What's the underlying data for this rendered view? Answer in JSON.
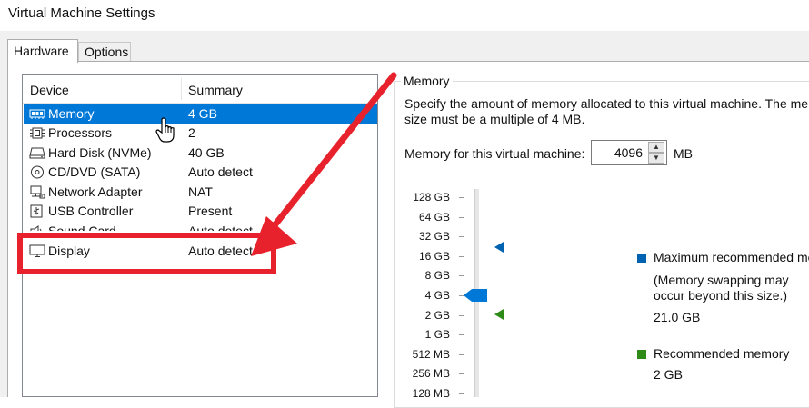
{
  "window": {
    "title": "Virtual Machine Settings"
  },
  "tabs": [
    {
      "label": "Hardware",
      "active": true
    },
    {
      "label": "Options",
      "active": false
    }
  ],
  "device_list": {
    "columns": {
      "device": "Device",
      "summary": "Summary"
    },
    "rows": [
      {
        "icon": "memory-icon",
        "device": "Memory",
        "summary": "4 GB",
        "selected": true
      },
      {
        "icon": "processor-icon",
        "device": "Processors",
        "summary": "2",
        "selected": false
      },
      {
        "icon": "hard-disk-icon",
        "device": "Hard Disk (NVMe)",
        "summary": "40 GB",
        "selected": false
      },
      {
        "icon": "cd-dvd-icon",
        "device": "CD/DVD (SATA)",
        "summary": "Auto detect",
        "selected": false
      },
      {
        "icon": "network-adapter-icon",
        "device": "Network Adapter",
        "summary": "NAT",
        "selected": false
      },
      {
        "icon": "usb-controller-icon",
        "device": "USB Controller",
        "summary": "Present",
        "selected": false
      },
      {
        "icon": "sound-card-icon",
        "device": "Sound Card",
        "summary": "Auto detect",
        "selected": false
      },
      {
        "icon": "display-icon",
        "device": "Display",
        "summary": "Auto detect",
        "selected": false
      }
    ]
  },
  "memory": {
    "group_title": "Memory",
    "description_line1": "Specify the amount of memory allocated to this virtual machine. The mem",
    "description_line2": "size must be a multiple of 4 MB.",
    "field_label": "Memory for this virtual machine:",
    "value": "4096",
    "unit": "MB",
    "scale": [
      "128 GB",
      "64 GB",
      "32 GB",
      "16 GB",
      "8 GB",
      "4 GB",
      "2 GB",
      "1 GB",
      "512 MB",
      "256 MB",
      "128 MB"
    ],
    "max_recommended": {
      "label": "Maximum recommended mem",
      "note_line1": "(Memory swapping may",
      "note_line2": "occur beyond this size.)",
      "value": "21.0 GB"
    },
    "recommended": {
      "label": "Recommended memory",
      "value": "2 GB"
    }
  },
  "colors": {
    "selection": "#0078d7",
    "annotation_red": "#e8222c",
    "max_marker": "#0063b1",
    "recommended_marker": "#2e8b18"
  }
}
